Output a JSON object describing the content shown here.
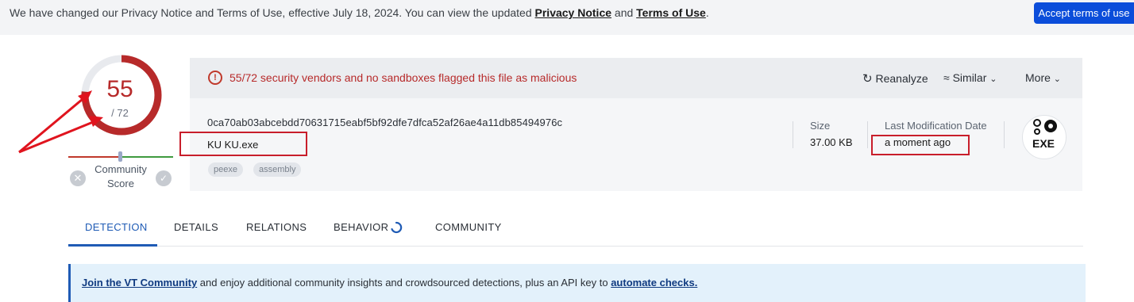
{
  "banner": {
    "text_before": "We have changed our Privacy Notice and Terms of Use, effective July 18, 2024. You can view the updated ",
    "privacy_link": "Privacy Notice",
    "and": " and ",
    "terms_link": "Terms of Use",
    "end": ".",
    "accept_button": "Accept terms of use"
  },
  "score": {
    "detections": "55",
    "total": "/ 72",
    "ratio": 0.764,
    "community_label_1": "Community",
    "community_label_2": "Score",
    "x_icon": "close-icon",
    "check_icon": "check-icon"
  },
  "alert": {
    "icon": "alert-circle-icon",
    "text": "55/72 security vendors and no sandboxes flagged this file as malicious",
    "color": "#b72a2a"
  },
  "actions": {
    "reanalyze": "Reanalyze",
    "similar": "Similar",
    "more": "More"
  },
  "file": {
    "hash": "0ca70ab03abcebdd70631715eabf5bf92dfe7dfca52af26ae4a11db85494976c",
    "name": "KU KU.exe",
    "tags": [
      "peexe",
      "assembly"
    ],
    "size_label": "Size",
    "size_value": "37.00 KB",
    "lastmod_label": "Last Modification Date",
    "lastmod_value": "a moment ago",
    "type_badge": "EXE"
  },
  "tabs": [
    "DETECTION",
    "DETAILS",
    "RELATIONS",
    "BEHAVIOR",
    "COMMUNITY"
  ],
  "active_tab": "DETECTION",
  "community_banner": {
    "link1": "Join the VT Community",
    "middle": " and enjoy additional community insights and crowdsourced detections, plus an API key to ",
    "link2": "automate checks.",
    "accent": "#1f5bb5"
  }
}
